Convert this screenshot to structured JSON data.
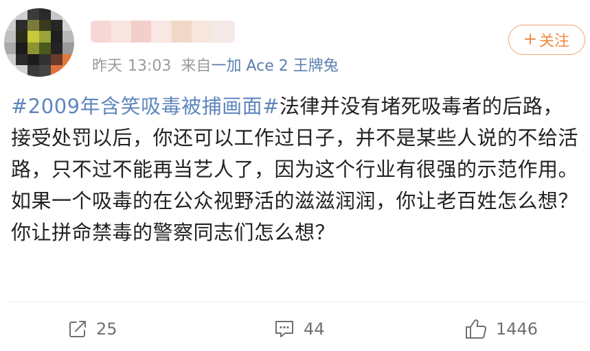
{
  "header": {
    "post_time_day": "昨天",
    "post_time": "13:03",
    "source_prefix": "来自",
    "source_device": "一加 Ace 2 王牌兔",
    "follow_label": "关注"
  },
  "post": {
    "hashtag": "#2009年含笑吸毒被捕画面#",
    "text": "法律并没有堵死吸毒者的后路，接受处罚以后，你还可以工作过日子，并不是某些人说的不给活路，只不过不能再当艺人了，因为这个行业有很强的示范作用。如果一个吸毒的在公众视野活的滋滋润润，你让老百姓怎么想？你让拼命禁毒的警察同志们怎么想？"
  },
  "actions": {
    "repost_count": "25",
    "comment_count": "44",
    "like_count": "1446"
  },
  "colors": {
    "hashtag": "#5f86bd",
    "follow_accent": "#f08a3e",
    "meta_gray": "#9a9a9a"
  },
  "icons": [
    "repost-icon",
    "comment-icon",
    "like-icon",
    "plus-icon"
  ]
}
